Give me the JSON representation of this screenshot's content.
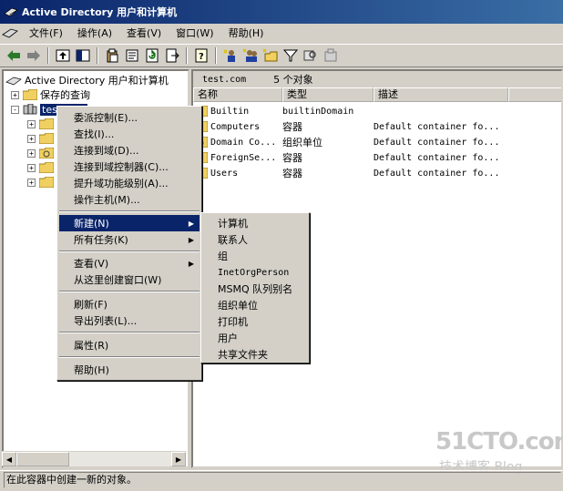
{
  "window": {
    "title": "Active Directory 用户和计算机"
  },
  "menubar": {
    "items": [
      "文件(F)",
      "操作(A)",
      "查看(V)",
      "窗口(W)",
      "帮助(H)"
    ]
  },
  "tree": {
    "root": "Active Directory 用户和计算机",
    "saved_queries": "保存的查询",
    "domain": "test.com"
  },
  "right": {
    "header_path": "test.com",
    "header_count": "5 个对象",
    "columns": [
      "名称",
      "类型",
      "描述"
    ],
    "rows": [
      {
        "name": "Builtin",
        "type": "builtinDomain",
        "desc": ""
      },
      {
        "name": "Computers",
        "type": "容器",
        "desc": "Default container fo..."
      },
      {
        "name": "Domain Co...",
        "type": "组织单位",
        "desc": "Default container fo..."
      },
      {
        "name": "ForeignSe...",
        "type": "容器",
        "desc": "Default container fo..."
      },
      {
        "name": "Users",
        "type": "容器",
        "desc": "Default container fo..."
      }
    ]
  },
  "context_menu": {
    "items": [
      "委派控制(E)...",
      "查找(I)...",
      "连接到域(D)...",
      "连接到域控制器(C)...",
      "提升域功能级别(A)...",
      "操作主机(M)...",
      "新建(N)",
      "所有任务(K)",
      "查看(V)",
      "从这里创建窗口(W)",
      "刷新(F)",
      "导出列表(L)...",
      "属性(R)",
      "帮助(H)"
    ]
  },
  "submenu": {
    "items": [
      "计算机",
      "联系人",
      "组",
      "InetOrgPerson",
      "MSMQ 队列别名",
      "组织单位",
      "打印机",
      "用户",
      "共享文件夹"
    ]
  },
  "status": "在此容器中创建一新的对象。",
  "watermark": {
    "line1": "51CTO.com",
    "line2": "技术博客  Blog"
  }
}
